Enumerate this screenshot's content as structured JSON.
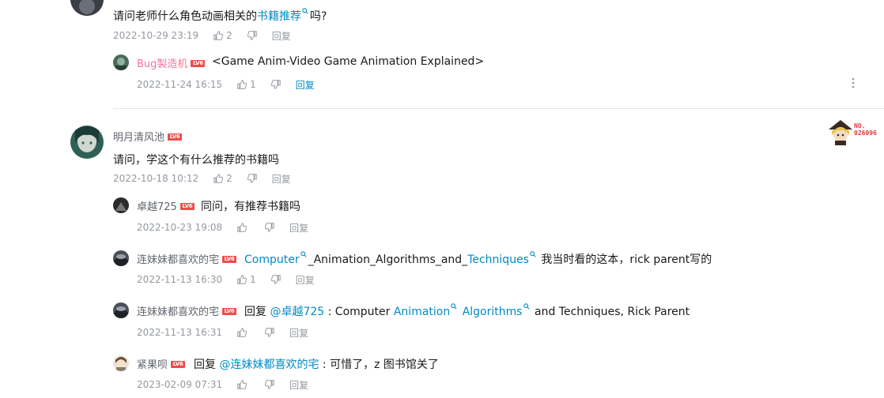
{
  "comments": [
    {
      "avatar_color": "#3a3d45",
      "text_parts": [
        {
          "t": "请问老师什么角色动画相关的"
        },
        {
          "t": "书籍推荐",
          "link": true
        },
        {
          "t": "吗?"
        }
      ],
      "time": "2022-10-29 23:19",
      "likes": "2",
      "reply_label": "回复",
      "replies": [
        {
          "user": "Bug製造机",
          "level": "LV6",
          "name_color": "#fb7299",
          "avatar_color": "#4b6a5a",
          "text_parts": [
            {
              "t": "<Game Anim-Video Game Animation Explained>"
            }
          ],
          "time": "2022-11-24 16:15",
          "likes": "1",
          "reply_label": "回复"
        }
      ]
    },
    {
      "user": "明月清风池",
      "level": "LV6",
      "avatar_color": "#2f5f55",
      "text_parts": [
        {
          "t": "请问，学这个有什么推荐的书籍吗"
        }
      ],
      "time": "2022-10-18 10:12",
      "likes": "2",
      "reply_label": "回复",
      "pendant_no": "NO.",
      "pendant_num": "026096",
      "replies": [
        {
          "user": "卓越725",
          "level": "LV6",
          "avatar_color": "#2b2b2b",
          "text_parts": [
            {
              "t": "同问，有推荐书籍吗"
            }
          ],
          "time": "2022-10-23 19:08",
          "likes": "",
          "reply_label": "回复"
        },
        {
          "user": "连妹妹都喜欢的宅",
          "level": "LV6",
          "avatar_color": "#4a4f57",
          "text_parts": [
            {
              "t": "Computer",
              "link": true,
              "icon": true
            },
            {
              "t": "_Animation_Algorithms_and_"
            },
            {
              "t": "Techniques",
              "link": true,
              "icon": true
            },
            {
              "t": " 我当时看的这本，rick parent写的"
            }
          ],
          "time": "2022-11-13 16:30",
          "likes": "1",
          "reply_label": "回复"
        },
        {
          "user": "连妹妹都喜欢的宅",
          "level": "LV6",
          "avatar_color": "#4a4f57",
          "text_parts": [
            {
              "t": "回复 "
            },
            {
              "t": "@卓越725",
              "link": true
            },
            {
              "t": " : Computer "
            },
            {
              "t": "Animation",
              "link": true,
              "icon": true
            },
            {
              "t": " "
            },
            {
              "t": "Algorithms",
              "link": true,
              "icon": true
            },
            {
              "t": " and Techniques, Rick Parent"
            }
          ],
          "time": "2022-11-13 16:31",
          "likes": "",
          "reply_label": "回复"
        },
        {
          "user": "紧果呗",
          "level": "LV6",
          "avatar_color": "#8a7a6a",
          "text_parts": [
            {
              "t": "回复 "
            },
            {
              "t": "@连妹妹都喜欢的宅",
              "link": true
            },
            {
              "t": " : 可惜了，z 图书馆关了"
            }
          ],
          "time": "2023-02-09 07:31",
          "likes": "",
          "reply_label": "回复"
        }
      ]
    }
  ],
  "colors": {
    "link": "#008ac5",
    "meta": "#9499a0",
    "level_badge": "#f04c49",
    "vip_name": "#fb7299"
  }
}
